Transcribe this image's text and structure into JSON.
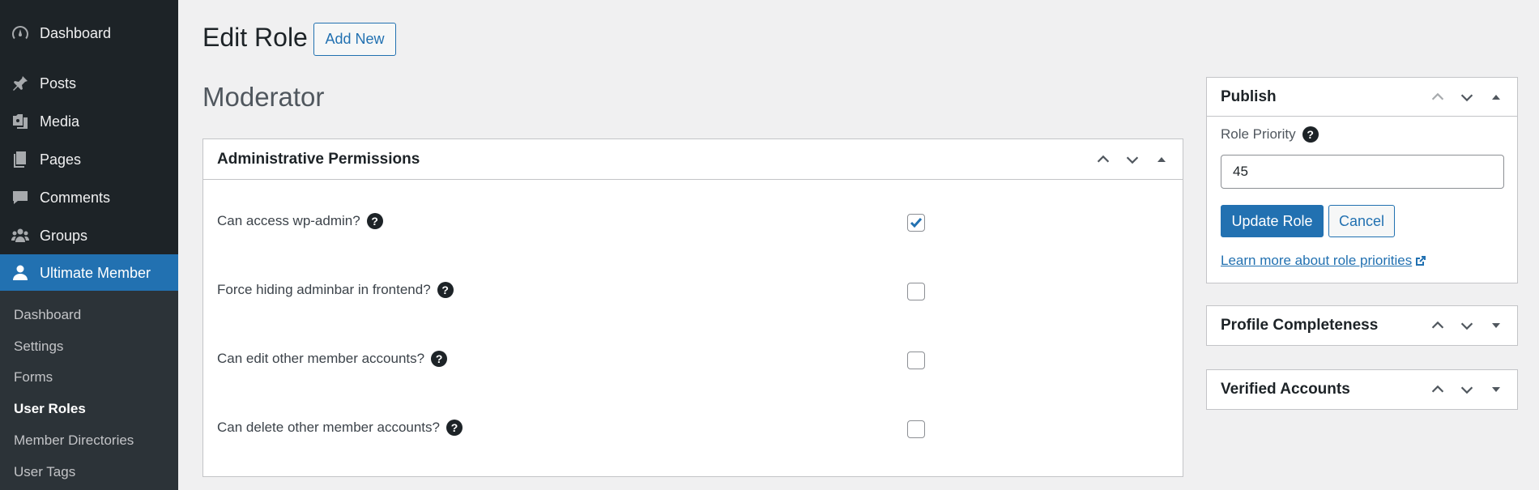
{
  "sidebar": {
    "items": [
      {
        "label": "Dashboard",
        "icon": "dashboard-icon"
      },
      {
        "label": "Posts",
        "icon": "pin-icon"
      },
      {
        "label": "Media",
        "icon": "media-icon"
      },
      {
        "label": "Pages",
        "icon": "pages-icon"
      },
      {
        "label": "Comments",
        "icon": "comments-icon"
      },
      {
        "label": "Groups",
        "icon": "groups-icon"
      },
      {
        "label": "Ultimate Member",
        "icon": "user-icon",
        "active": true
      }
    ],
    "submenu": [
      {
        "label": "Dashboard"
      },
      {
        "label": "Settings"
      },
      {
        "label": "Forms"
      },
      {
        "label": "User Roles",
        "current": true
      },
      {
        "label": "Member Directories"
      },
      {
        "label": "User Tags"
      }
    ]
  },
  "header": {
    "title": "Edit Role",
    "add_new_label": "Add New",
    "role_name": "Moderator"
  },
  "permissions": {
    "title": "Administrative Permissions",
    "rows": [
      {
        "label": "Can access wp-admin?",
        "checked": true
      },
      {
        "label": "Force hiding adminbar in frontend?",
        "checked": false
      },
      {
        "label": "Can edit other member accounts?",
        "checked": false
      },
      {
        "label": "Can delete other member accounts?",
        "checked": false
      }
    ]
  },
  "publish": {
    "title": "Publish",
    "priority_label": "Role Priority",
    "priority_value": "45",
    "update_label": "Update Role",
    "cancel_label": "Cancel",
    "learn_more": "Learn more about role priorities"
  },
  "profile_completeness": {
    "title": "Profile Completeness"
  },
  "verified_accounts": {
    "title": "Verified Accounts"
  },
  "help_glyph": "?",
  "colors": {
    "sidebar_bg": "#1d2327",
    "submenu_bg": "#2c3338",
    "accent": "#2271b1",
    "page_bg": "#f0f0f1"
  }
}
